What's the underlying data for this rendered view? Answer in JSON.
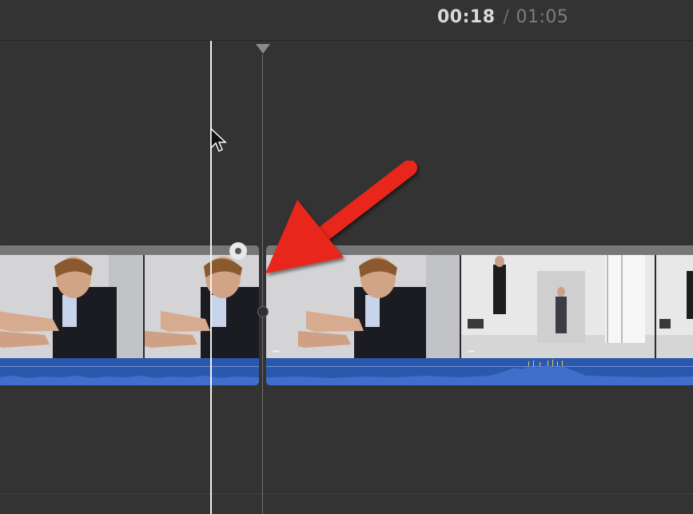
{
  "timecode": {
    "current": "00:18",
    "separator": "/",
    "total": "01:05"
  },
  "clips": [
    {
      "name": "clip-1",
      "frames": 2
    },
    {
      "name": "clip-2",
      "frames": 3
    }
  ],
  "colors": {
    "background": "#333333",
    "audio_waveform": "#2a58ad",
    "annotation_arrow": "#e8261a",
    "skimmer": "#f2f2f2",
    "playhead": "#6e6e6e"
  },
  "icons": {
    "transition_handle": "transition-handle-icon",
    "cursor": "mouse-pointer-icon",
    "arrow": "annotation-arrow-icon"
  }
}
